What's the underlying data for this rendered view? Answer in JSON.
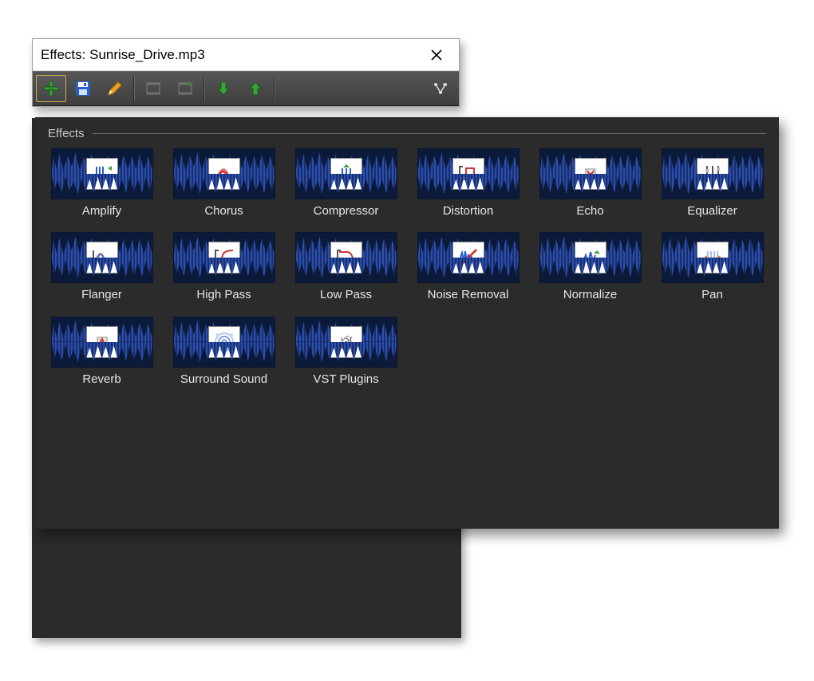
{
  "window": {
    "title": "Effects: Sunrise_Drive.mp3"
  },
  "toolbar": {
    "buttons": [
      {
        "id": "add",
        "name": "add-effect",
        "selected": true
      },
      {
        "id": "save",
        "name": "save-preset",
        "selected": false
      },
      {
        "id": "edit",
        "name": "edit-effect",
        "selected": false
      },
      {
        "id": "sep"
      },
      {
        "id": "chain1",
        "name": "chain-insert",
        "selected": false,
        "dim": true
      },
      {
        "id": "chain2",
        "name": "chain-add",
        "selected": false,
        "dim": true
      },
      {
        "id": "sep"
      },
      {
        "id": "down",
        "name": "move-down",
        "selected": false
      },
      {
        "id": "up",
        "name": "move-up",
        "selected": false
      },
      {
        "id": "sep"
      },
      {
        "id": "spacer"
      },
      {
        "id": "route",
        "name": "routing",
        "selected": false
      }
    ]
  },
  "panel": {
    "group_label": "Effects",
    "effects": [
      {
        "id": "amplify",
        "label": "Amplify"
      },
      {
        "id": "chorus",
        "label": "Chorus"
      },
      {
        "id": "compressor",
        "label": "Compressor"
      },
      {
        "id": "distortion",
        "label": "Distortion"
      },
      {
        "id": "echo",
        "label": "Echo"
      },
      {
        "id": "equalizer",
        "label": "Equalizer"
      },
      {
        "id": "flanger",
        "label": "Flanger"
      },
      {
        "id": "highpass",
        "label": "High Pass"
      },
      {
        "id": "lowpass",
        "label": "Low Pass"
      },
      {
        "id": "noiseremoval",
        "label": "Noise Removal"
      },
      {
        "id": "normalize",
        "label": "Normalize"
      },
      {
        "id": "pan",
        "label": "Pan"
      },
      {
        "id": "reverb",
        "label": "Reverb"
      },
      {
        "id": "surround",
        "label": "Surround Sound"
      },
      {
        "id": "vst",
        "label": "VST Plugins"
      }
    ]
  }
}
